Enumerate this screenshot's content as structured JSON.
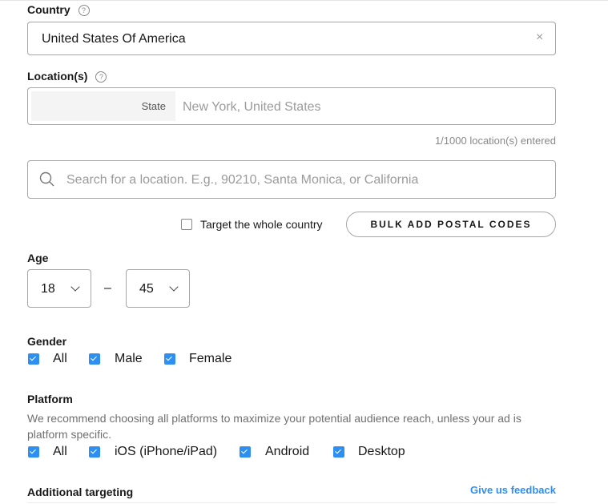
{
  "country": {
    "label": "Country",
    "help": "?",
    "value": "United States Of America",
    "clear_icon": "×"
  },
  "locations": {
    "label": "Location(s)",
    "help": "?",
    "entries": [
      {
        "type": "State",
        "value": "New York, United States"
      }
    ],
    "count_text": "1/1000 location(s) entered",
    "search_placeholder": "Search for a location. E.g., 90210, Santa Monica, or California",
    "whole_country_label": "Target the whole country",
    "whole_country_checked": false,
    "bulk_button": "BULK ADD POSTAL CODES"
  },
  "age": {
    "label": "Age",
    "min": "18",
    "separator": "–",
    "max": "45"
  },
  "gender": {
    "label": "Gender",
    "options": [
      {
        "label": "All",
        "checked": true
      },
      {
        "label": "Male",
        "checked": true
      },
      {
        "label": "Female",
        "checked": true
      }
    ]
  },
  "platform": {
    "label": "Platform",
    "description": "We recommend choosing all platforms to maximize your potential audience reach, unless your ad is platform specific.",
    "options": [
      {
        "label": "All",
        "checked": true
      },
      {
        "label": "iOS (iPhone/iPad)",
        "checked": true
      },
      {
        "label": "Android",
        "checked": true
      },
      {
        "label": "Desktop",
        "checked": true
      }
    ]
  },
  "additional": {
    "label": "Additional targeting",
    "feedback_link": "Give us feedback"
  },
  "colors": {
    "accent": "#2e8ff0",
    "border": "#a6a6a6"
  }
}
